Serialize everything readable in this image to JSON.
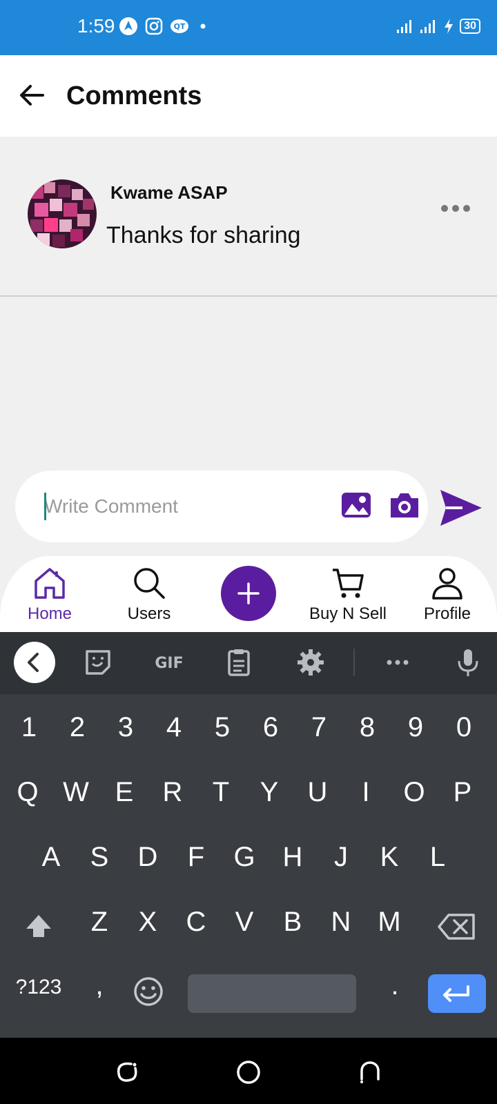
{
  "status_bar": {
    "time": "1:59",
    "battery": "30",
    "icons": [
      "navigation-icon",
      "instagram-icon",
      "qt-icon",
      "dot-icon",
      "signal-icon",
      "signal-icon",
      "charging-icon",
      "battery-icon"
    ]
  },
  "header": {
    "title": "Comments"
  },
  "comments": [
    {
      "author": "Kwame ASAP",
      "text": "Thanks for sharing"
    }
  ],
  "composer": {
    "placeholder": "Write Comment",
    "value": ""
  },
  "bottom_nav": {
    "items": [
      {
        "label": "Home",
        "icon": "home-icon",
        "active": true
      },
      {
        "label": "Users",
        "icon": "search-icon",
        "active": false
      },
      {
        "label": "Buy N Sell",
        "icon": "cart-icon",
        "active": false
      },
      {
        "label": "Profile",
        "icon": "person-icon",
        "active": false
      }
    ]
  },
  "keyboard": {
    "toolbar": {
      "gif_label": "GIF"
    },
    "rows": {
      "numbers": [
        "1",
        "2",
        "3",
        "4",
        "5",
        "6",
        "7",
        "8",
        "9",
        "0"
      ],
      "row1": [
        "Q",
        "W",
        "E",
        "R",
        "T",
        "Y",
        "U",
        "I",
        "O",
        "P"
      ],
      "row2": [
        "A",
        "S",
        "D",
        "F",
        "G",
        "H",
        "J",
        "K",
        "L"
      ],
      "row3": [
        "Z",
        "X",
        "C",
        "V",
        "B",
        "N",
        "M"
      ]
    },
    "symbols_label": "?123",
    "comma": ",",
    "period": "."
  },
  "colors": {
    "status_bar": "#1f88d9",
    "accent": "#5b1d9f",
    "keyboard_bg": "#3a3d42",
    "enter_key": "#4f8ff7"
  }
}
